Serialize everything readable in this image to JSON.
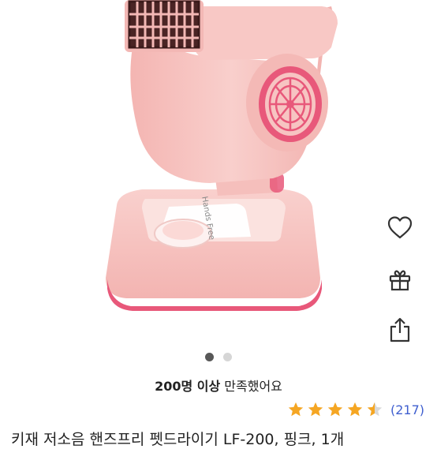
{
  "gallery": {
    "product_brand": "Hands Free",
    "page_count": 2,
    "active_index": 0
  },
  "actions": {
    "wishlist_icon": "heart-icon",
    "gift_icon": "gift-icon",
    "share_icon": "share-icon"
  },
  "satisfaction": {
    "strong": "200명 이상",
    "rest": " 만족했어요"
  },
  "rating": {
    "stars": 4.5,
    "count_text": "(217)",
    "star_color": "#f5a623"
  },
  "product": {
    "title": "키재 저소음 핸즈프리 펫드라이기 LF-200, 핑크, 1개"
  },
  "colors": {
    "pink_body": "#f7c4c2",
    "pink_accent": "#e8587a"
  }
}
